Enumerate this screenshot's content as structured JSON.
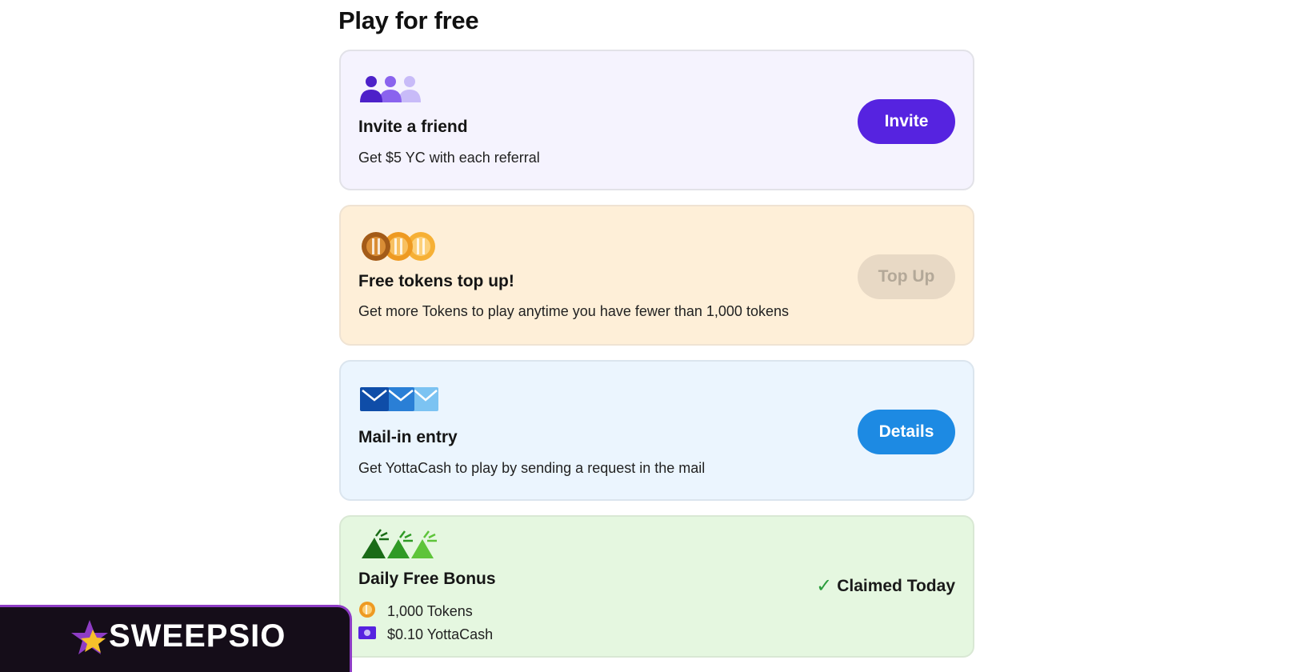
{
  "section": {
    "title": "Play for free"
  },
  "cards": [
    {
      "icon": "people-group-icon",
      "title": "Invite a friend",
      "description": "Get $5 YC with each referral",
      "button_label": "Invite",
      "button_color": "#5623e0"
    },
    {
      "icon": "coins-icon",
      "title": "Free tokens top up!",
      "description": "Get more Tokens to play anytime you have fewer than 1,000 tokens",
      "button_label": "Top Up",
      "button_state": "disabled"
    },
    {
      "icon": "envelopes-icon",
      "title": "Mail-in entry",
      "description": "Get YottaCash to play by sending a request in the mail",
      "button_label": "Details",
      "button_color": "#1d8ae3"
    },
    {
      "icon": "party-popper-icon",
      "title": "Daily Free Bonus",
      "status_label": "Claimed Today",
      "status_icon": "checkmark-icon",
      "rewards": [
        {
          "icon": "token-coin-icon",
          "label": "1,000 Tokens"
        },
        {
          "icon": "cash-bill-icon",
          "label": "$0.10 YottaCash"
        }
      ]
    }
  ],
  "watermark": {
    "brand": "SWEEPSIO",
    "icon": "star-logo-icon"
  }
}
